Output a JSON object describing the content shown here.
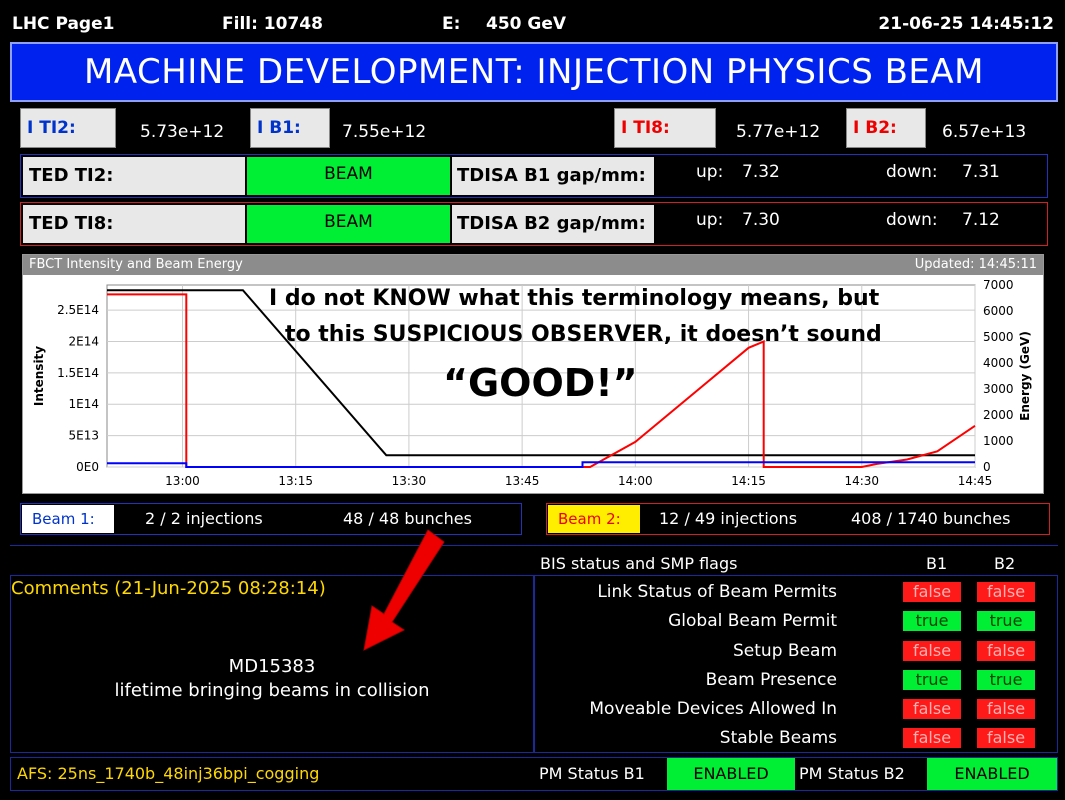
{
  "topbar": {
    "page": "LHC Page1",
    "fill": "Fill: 10748",
    "energy_label": "E:",
    "energy_value": "450 GeV",
    "datetime": "21-06-25 14:45:12"
  },
  "banner": "MACHINE DEVELOPMENT: INJECTION PHYSICS BEAM",
  "intensities": [
    {
      "label": "I TI2:",
      "value": "5.73e+12"
    },
    {
      "label": "I B1:",
      "value": "7.55e+12"
    },
    {
      "label": "I TI8:",
      "value": "5.77e+12"
    },
    {
      "label": "I B2:",
      "value": "6.57e+13"
    }
  ],
  "ted": [
    {
      "label": "TED TI2:",
      "status": "BEAM",
      "tdisa_label": "TDISA B1 gap/mm:",
      "up_label": "up:",
      "up": "7.32",
      "down_label": "down:",
      "down": "7.31"
    },
    {
      "label": "TED TI8:",
      "status": "BEAM",
      "tdisa_label": "TDISA B2 gap/mm:",
      "up_label": "up:",
      "up": "7.30",
      "down_label": "down:",
      "down": "7.12"
    }
  ],
  "chart_header": {
    "title": "FBCT Intensity and Beam Energy",
    "updated": "Updated: 14:45:11"
  },
  "annotation": {
    "line1": "I do not KNOW what this terminology means, but",
    "line2": "to this SUSPICIOUS OBSERVER, it doesn’t sound",
    "line3": "“GOOD!”"
  },
  "chart_data": {
    "type": "line",
    "ylabel": "Intensity",
    "y2label": "Energy (GeV)",
    "x_ticks": [
      "13:00",
      "13:15",
      "13:30",
      "13:45",
      "14:00",
      "14:15",
      "14:30",
      "14:45"
    ],
    "x_tick_minutes": [
      780,
      795,
      810,
      825,
      840,
      855,
      870,
      885
    ],
    "xlim_minutes": [
      770,
      885
    ],
    "y_ticks": [
      "0E0",
      "5E13",
      "1E14",
      "1.5E14",
      "2E14",
      "2.5E14"
    ],
    "y_tick_values": [
      0,
      50000000000000.0,
      100000000000000.0,
      150000000000000.0,
      200000000000000.0,
      250000000000000.0
    ],
    "ylim": [
      0,
      290000000000000.0
    ],
    "y2_ticks": [
      "0",
      "1000",
      "2000",
      "3000",
      "4000",
      "5000",
      "6000",
      "7000"
    ],
    "y2_tick_values": [
      0,
      1000,
      2000,
      3000,
      4000,
      5000,
      6000,
      7000
    ],
    "y2lim": [
      0,
      7000
    ],
    "grid": true,
    "series": [
      {
        "color": "#000000",
        "axis": "y2",
        "x": [
          770,
          788,
          807,
          826,
          826.5,
          885
        ],
        "y": [
          6800,
          6800,
          450,
          450,
          450,
          450
        ]
      },
      {
        "color": "#ff0000",
        "axis": "y1",
        "x": [
          770,
          780.5,
          780.5,
          825,
          834,
          840,
          855,
          857,
          857,
          870,
          872,
          876,
          880,
          885
        ],
        "y": [
          275000000000000.0,
          275000000000000.0,
          0,
          0,
          0,
          40000000000000.0,
          190000000000000.0,
          200000000000000.0,
          0,
          0,
          5000000000000.0,
          12000000000000.0,
          25000000000000.0,
          65700000000000.0
        ]
      },
      {
        "color": "#0000ff",
        "axis": "y1",
        "x": [
          770,
          780.5,
          780.5,
          833,
          833,
          870,
          885
        ],
        "y": [
          6000000000000.0,
          6000000000000.0,
          0,
          0,
          7500000000000.0,
          7500000000000.0,
          7500000000000.0
        ]
      }
    ]
  },
  "beam1": {
    "label": "Beam 1:",
    "injections": "2 / 2 injections",
    "bunches": "48 / 48 bunches"
  },
  "beam2": {
    "label": "Beam 2:",
    "injections": "12 / 49 injections",
    "bunches": "408 / 1740 bunches"
  },
  "comments": {
    "header": "Comments (21-Jun-2025 08:28:14)",
    "line1": "MD15383",
    "line2": "lifetime bringing beams in collision"
  },
  "bis": {
    "title": "BIS status and SMP flags",
    "col1": "B1",
    "col2": "B2",
    "rows": [
      {
        "label": "Link Status of Beam Permits",
        "b1": "false",
        "b2": "false"
      },
      {
        "label": "Global Beam Permit",
        "b1": "true",
        "b2": "true"
      },
      {
        "label": "Setup Beam",
        "b1": "false",
        "b2": "false"
      },
      {
        "label": "Beam Presence",
        "b1": "true",
        "b2": "true"
      },
      {
        "label": "Moveable Devices Allowed In",
        "b1": "false",
        "b2": "false"
      },
      {
        "label": "Stable Beams",
        "b1": "false",
        "b2": "false"
      }
    ]
  },
  "footer": {
    "afs": "AFS: 25ns_1740b_48inj36bpi_cogging",
    "pm1_label": "PM Status B1",
    "pm1": "ENABLED",
    "pm2_label": "PM Status B2",
    "pm2": "ENABLED"
  },
  "colors": {
    "banner": "#0022ee",
    "green": "#00ee33",
    "red": "#ff1a1a",
    "yellow": "#ffd800",
    "arrow": "#ee0000"
  }
}
